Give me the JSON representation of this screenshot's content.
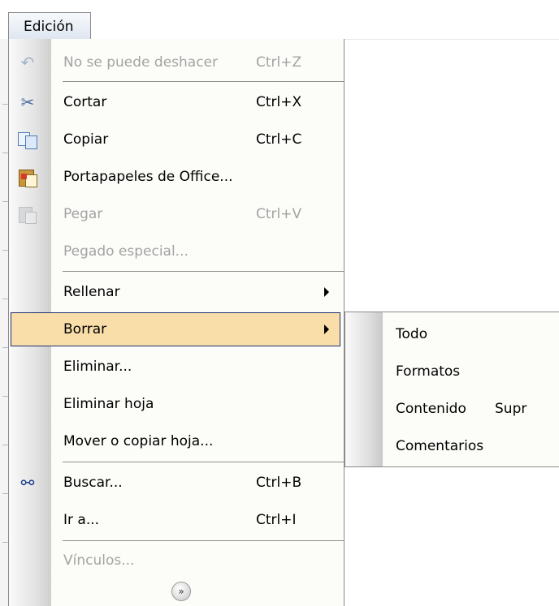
{
  "menubar": {
    "title": "Edición"
  },
  "menu": {
    "items": [
      {
        "label": "No se puede deshacer",
        "shortcut": "Ctrl+Z",
        "icon": "undo-icon",
        "disabled": true
      },
      {
        "label": "Cortar",
        "shortcut": "Ctrl+X",
        "icon": "scissors-icon"
      },
      {
        "label": "Copiar",
        "shortcut": "Ctrl+C",
        "icon": "copy-icon"
      },
      {
        "label": "Portapapeles de Office...",
        "shortcut": "",
        "icon": "office-clipboard-icon"
      },
      {
        "label": "Pegar",
        "shortcut": "Ctrl+V",
        "icon": "paste-icon",
        "disabled": true
      },
      {
        "label": "Pegado especial...",
        "shortcut": "",
        "disabled": true
      },
      {
        "label": "Rellenar",
        "has_submenu": true
      },
      {
        "label": "Borrar",
        "has_submenu": true,
        "highlighted": true
      },
      {
        "label": "Eliminar..."
      },
      {
        "label": "Eliminar hoja"
      },
      {
        "label": "Mover o copiar hoja..."
      },
      {
        "label": "Buscar...",
        "shortcut": "Ctrl+B",
        "icon": "binoculars-icon"
      },
      {
        "label": "Ir a...",
        "shortcut": "Ctrl+I"
      },
      {
        "label": "Vínculos...",
        "disabled": true
      }
    ],
    "expand_icon": "expand-double-chevron-icon"
  },
  "submenu": {
    "parent": "Borrar",
    "items": [
      {
        "label": "Todo"
      },
      {
        "label": "Formatos"
      },
      {
        "label": "Contenido",
        "shortcut": "Supr"
      },
      {
        "label": "Comentarios"
      }
    ]
  },
  "colors": {
    "highlight_fill": "#f9dea9",
    "highlight_border": "#1d2f72",
    "disabled_text": "#a3a3a3",
    "menu_background": "#fcfcf9"
  }
}
